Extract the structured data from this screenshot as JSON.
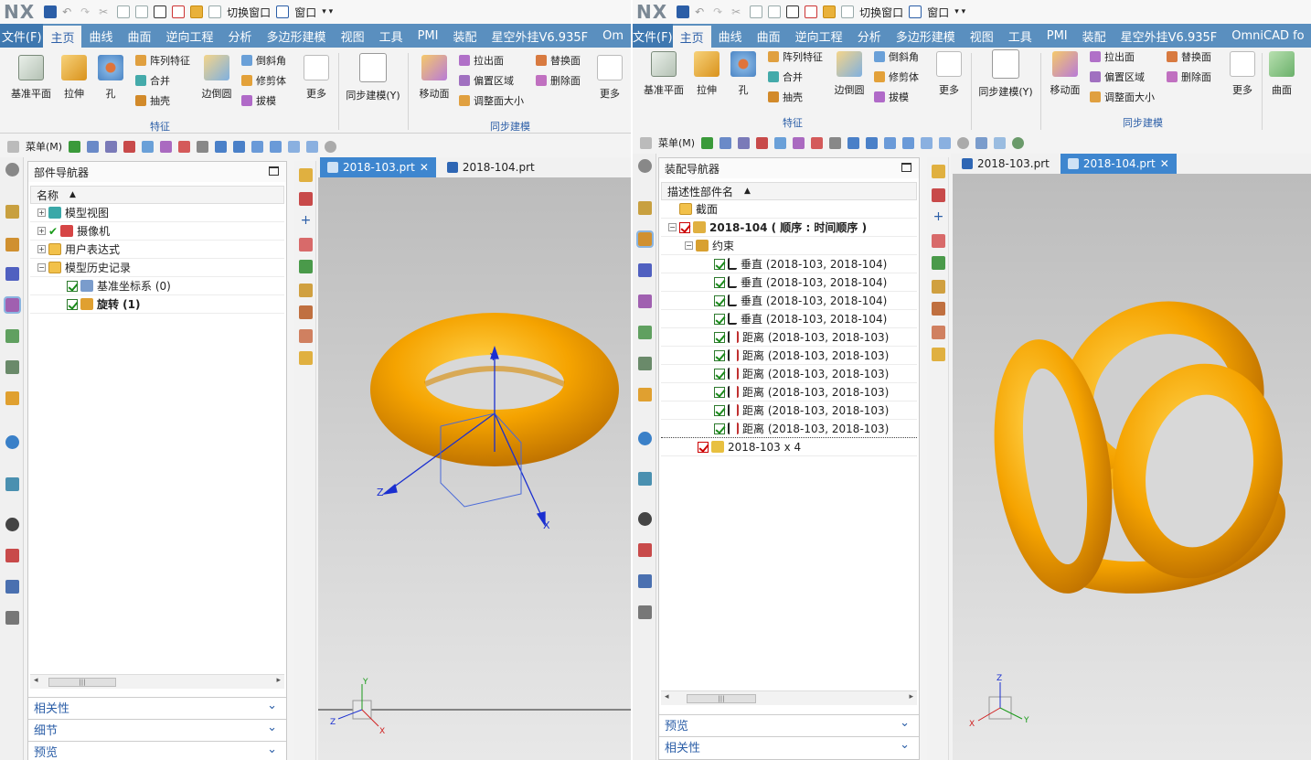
{
  "left": {
    "logo": "NX",
    "quick_access": {
      "switch_window": "切换窗口",
      "window": "窗口"
    },
    "file_menu": "文件(F)",
    "tabs": [
      "主页",
      "曲线",
      "曲面",
      "逆向工程",
      "分析",
      "多边形建模",
      "视图",
      "工具",
      "PMI",
      "装配",
      "星空外挂V6.935F",
      "Om"
    ],
    "ribbon": {
      "datum_plane": "基准平面",
      "extrude": "拉伸",
      "hole": "孔",
      "pattern_feature": "阵列特征",
      "unite": "合并",
      "shell": "抽壳",
      "edge_blend": "边倒圆",
      "chamfer": "倒斜角",
      "trim_body": "修剪体",
      "draft": "拔模",
      "more": "更多",
      "sync_modeling": "同步建模(Y)",
      "move_face": "移动面",
      "pull_face": "拉出面",
      "offset_region": "偏置区域",
      "resize_face": "调整面大小",
      "replace_face": "替换面",
      "delete_face": "删除面",
      "more2": "更多",
      "group_feature": "特征",
      "group_sync": "同步建模"
    },
    "menu_button": "菜单(M)",
    "navigator": {
      "title": "部件导航器",
      "column": "名称",
      "rows": [
        {
          "label": "模型视图"
        },
        {
          "label": "摄像机"
        },
        {
          "label": "用户表达式"
        },
        {
          "label": "模型历史记录"
        },
        {
          "label": "基准坐标系 (0)"
        },
        {
          "label": "旋转 (1)"
        }
      ]
    },
    "sections": [
      "相关性",
      "细节",
      "预览"
    ],
    "doc_tabs": [
      "2018-103.prt",
      "2018-104.prt"
    ],
    "axes": {
      "x": "X",
      "y": "Y",
      "z": "Z"
    }
  },
  "right": {
    "logo": "NX",
    "quick_access": {
      "switch_window": "切换窗口",
      "window": "窗口"
    },
    "file_menu": "文件(F)",
    "tabs": [
      "主页",
      "曲线",
      "曲面",
      "逆向工程",
      "分析",
      "多边形建模",
      "视图",
      "工具",
      "PMI",
      "装配",
      "星空外挂V6.935F",
      "OmniCAD fo"
    ],
    "ribbon": {
      "datum_plane": "基准平面",
      "extrude": "拉伸",
      "hole": "孔",
      "pattern_feature": "阵列特征",
      "unite": "合并",
      "shell": "抽壳",
      "edge_blend": "边倒圆",
      "chamfer": "倒斜角",
      "trim_body": "修剪体",
      "draft": "拔模",
      "more": "更多",
      "sync_modeling": "同步建模(Y)",
      "move_face": "移动面",
      "pull_face": "拉出面",
      "offset_region": "偏置区域",
      "resize_face": "调整面大小",
      "replace_face": "替换面",
      "delete_face": "删除面",
      "more2": "更多",
      "surface": "曲面",
      "group_feature": "特征",
      "group_sync": "同步建模"
    },
    "menu_button": "菜单(M)",
    "navigator": {
      "title": "装配导航器",
      "column": "描述性部件名",
      "rows": [
        {
          "label": "截面"
        },
        {
          "label": "2018-104 ( 顺序 : 时间顺序 )"
        },
        {
          "label": "约束"
        },
        {
          "label": "垂直 (2018-103, 2018-104)"
        },
        {
          "label": "垂直 (2018-103, 2018-104)"
        },
        {
          "label": "垂直 (2018-103, 2018-104)"
        },
        {
          "label": "垂直 (2018-103, 2018-104)"
        },
        {
          "label": "距离 (2018-103, 2018-103)"
        },
        {
          "label": "距离 (2018-103, 2018-103)"
        },
        {
          "label": "距离 (2018-103, 2018-103)"
        },
        {
          "label": "距离 (2018-103, 2018-103)"
        },
        {
          "label": "距离 (2018-103, 2018-103)"
        },
        {
          "label": "距离 (2018-103, 2018-103)"
        },
        {
          "label": "2018-103 x 4"
        }
      ]
    },
    "sections": [
      "预览",
      "相关性"
    ],
    "doc_tabs": [
      "2018-103.prt",
      "2018-104.prt"
    ],
    "axes": {
      "x": "X",
      "y": "Y",
      "z": "Z"
    }
  },
  "colors": {
    "menubar": "#5a8fbf",
    "active_tab": "#3e86cf",
    "torus": "#f5a300",
    "accent": "#2b5ea7"
  }
}
